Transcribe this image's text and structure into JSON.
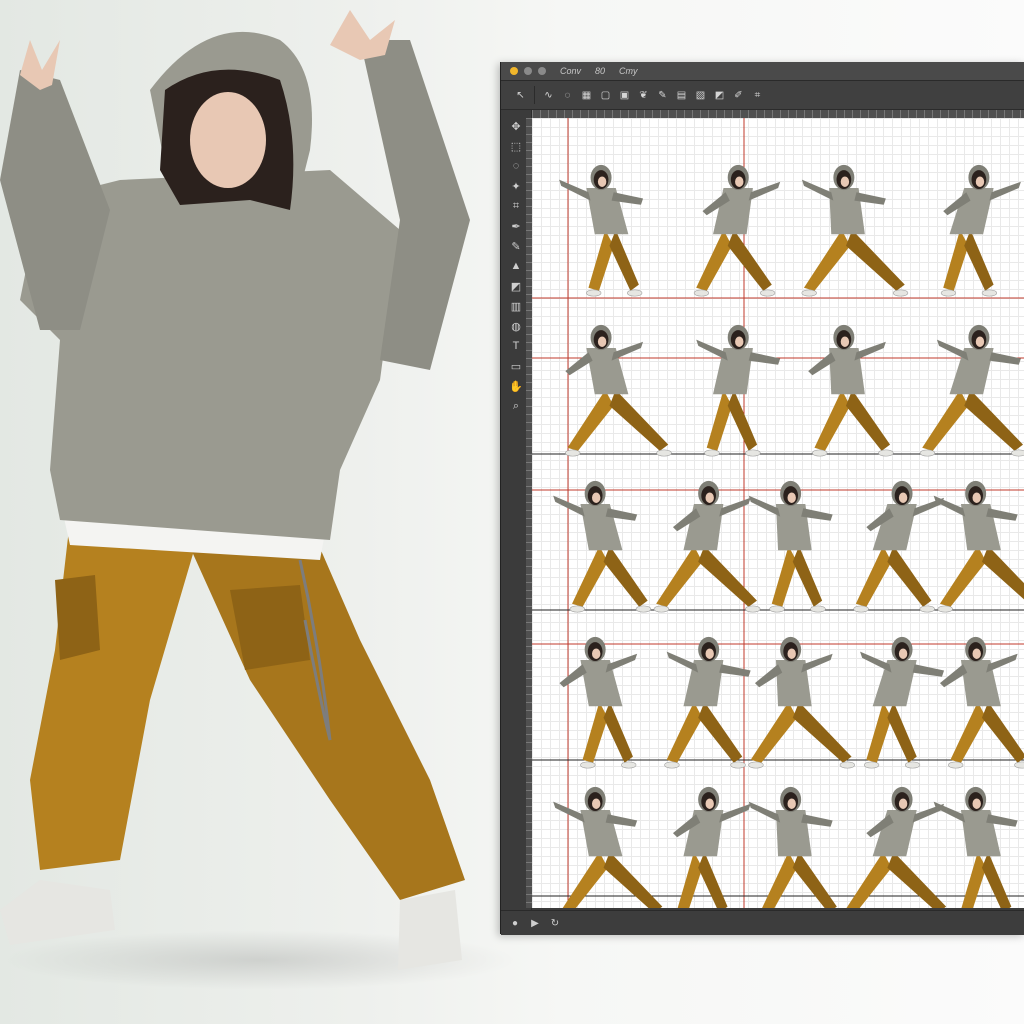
{
  "editor": {
    "title_menu": [
      "Conv",
      "80",
      "Cmy"
    ],
    "toolbar_tools": [
      {
        "icon": "arrow-tool-icon",
        "glyph": "↖"
      },
      {
        "icon": "curve-tool-icon",
        "glyph": "∿"
      },
      {
        "icon": "lasso-tool-icon",
        "glyph": "◌"
      },
      {
        "icon": "grid-tool-icon",
        "glyph": "▦"
      },
      {
        "icon": "frame-tool-icon",
        "glyph": "▢"
      },
      {
        "icon": "image-tool-icon",
        "glyph": "▣"
      },
      {
        "icon": "leaf-tool-icon",
        "glyph": "❦"
      },
      {
        "icon": "brush-tool-icon",
        "glyph": "✎"
      },
      {
        "icon": "layers-tool-icon",
        "glyph": "▤"
      },
      {
        "icon": "media-tool-icon",
        "glyph": "▧"
      },
      {
        "icon": "eraser-tool-icon",
        "glyph": "◩"
      },
      {
        "icon": "pen-tool-icon",
        "glyph": "✐"
      },
      {
        "icon": "crop-tool-icon",
        "glyph": "⌗"
      }
    ],
    "side_tools": [
      {
        "icon": "move-icon",
        "glyph": "✥"
      },
      {
        "icon": "select-icon",
        "glyph": "⬚"
      },
      {
        "icon": "lasso-icon",
        "glyph": "◌"
      },
      {
        "icon": "magic-wand-icon",
        "glyph": "✦"
      },
      {
        "icon": "crop-icon",
        "glyph": "⌗"
      },
      {
        "icon": "eyedropper-icon",
        "glyph": "✒"
      },
      {
        "icon": "brush-icon",
        "glyph": "✎"
      },
      {
        "icon": "stamp-icon",
        "glyph": "▲"
      },
      {
        "icon": "eraser-icon",
        "glyph": "◩"
      },
      {
        "icon": "gradient-icon",
        "glyph": "▥"
      },
      {
        "icon": "blur-icon",
        "glyph": "◍"
      },
      {
        "icon": "text-icon",
        "glyph": "T"
      },
      {
        "icon": "shape-icon",
        "glyph": "▭"
      },
      {
        "icon": "hand-icon",
        "glyph": "✋"
      },
      {
        "icon": "zoom-icon",
        "glyph": "⌕"
      }
    ],
    "status_icons": [
      {
        "icon": "record-icon",
        "glyph": "●"
      },
      {
        "icon": "play-icon",
        "glyph": "▶"
      },
      {
        "icon": "loop-icon",
        "glyph": "↻"
      }
    ],
    "sprite_rows": 5,
    "sprite_row_counts": [
      4,
      4,
      5,
      5,
      5
    ]
  },
  "colors": {
    "hoodie": "#9a9a90",
    "hoodie_shadow": "#7f7f76",
    "pants": "#b5811f",
    "pants_shadow": "#8e6316",
    "hair": "#2b211d",
    "skin": "#e8c8b4",
    "shirt": "#f4f4f2",
    "shoe": "#e6e6e2",
    "guide_red": "#c0392b",
    "guide_dark": "#222222"
  }
}
